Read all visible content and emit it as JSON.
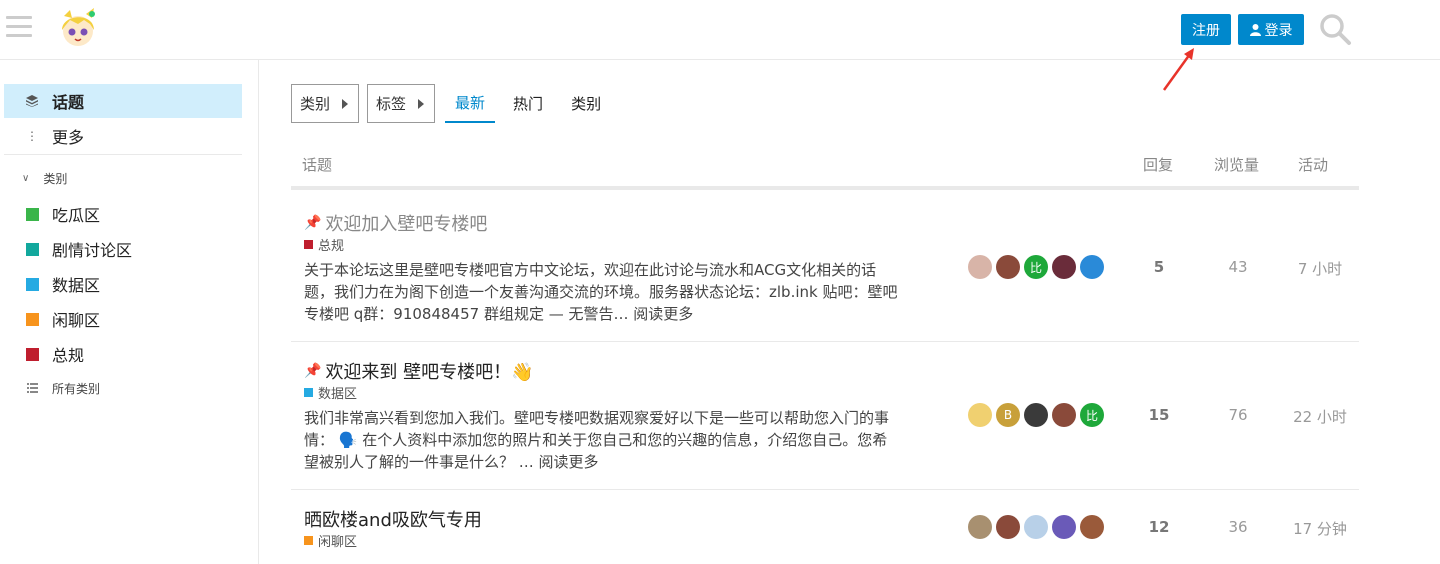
{
  "header": {
    "signup_label": "注册",
    "login_label": "登录"
  },
  "sidebar": {
    "topics_label": "话题",
    "more_label": "更多",
    "section_label": "类别",
    "categories": [
      {
        "name": "吃瓜区",
        "color": "#3ab54a"
      },
      {
        "name": "剧情讨论区",
        "color": "#12a89d"
      },
      {
        "name": "数据区",
        "color": "#25aae2"
      },
      {
        "name": "闲聊区",
        "color": "#f7941d"
      },
      {
        "name": "总规",
        "color": "#bf1e2e"
      }
    ],
    "all_categories_label": "所有类别"
  },
  "nav": {
    "category_drop": "类别",
    "tags_drop": "标签",
    "tabs": [
      "最新",
      "热门",
      "类别"
    ]
  },
  "table": {
    "headers": {
      "topic": "话题",
      "replies": "回复",
      "views": "浏览量",
      "activity": "活动"
    }
  },
  "topics": [
    {
      "title": "欢迎加入壁吧专楼吧",
      "category": "总规",
      "category_color": "#bf1e2e",
      "excerpt_lines": [
        "关于本论坛这里是壁吧专楼吧官方中文论坛，欢迎在此讨论与流水和ACG文化相关的话",
        "题，我们力在为阁下创造一个友善沟通交流的环境。服务器状态论坛：zlb.ink 贴吧：壁吧",
        "专楼吧 q群：910848457 群组规定 — 无警告… 阅读更多"
      ],
      "replies": "5",
      "views": "43",
      "activity": "7 小时"
    },
    {
      "title": "欢迎来到 壁吧专楼吧！👋",
      "category": "数据区",
      "category_color": "#25aae2",
      "excerpt_lines": [
        "我们非常高兴看到您加入我们。壁吧专楼吧数据观察爱好以下是一些可以帮助您入门的事",
        "情： 🗣️ 在个人资料中添加您的照片和关于您自己和您的兴趣的信息，介绍您自己。您希",
        "望被别人了解的一件事是什么？ … 阅读更多"
      ],
      "replies": "15",
      "views": "76",
      "activity": "22 小时"
    },
    {
      "title": "晒欧楼and吸欧气专用",
      "category": "闲聊区",
      "category_color": "#f7941d",
      "replies": "12",
      "views": "36",
      "activity": "17 分钟"
    }
  ],
  "avatar_letters": {
    "bi": "比",
    "b": "B"
  }
}
